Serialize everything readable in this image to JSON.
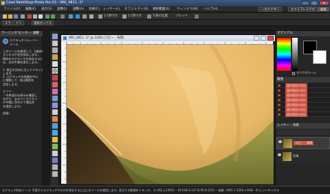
{
  "window": {
    "title": "Corel PaintShop Photo Pro X3 - IMG_4811 -1*",
    "minimize_glyph": "–",
    "maximize_glyph": "□",
    "close_glyph": "✕"
  },
  "menubar": {
    "items": [
      "ファイル(F)",
      "編集(E)",
      "表示(V)",
      "画像(I)",
      "調整(A)",
      "効果(C)",
      "レイヤー(L)",
      "オブジェクト(O)",
      "選択範囲(S)",
      "ウィンドウ(W)",
      "ヘルプ(H)"
    ],
    "workspace_buttons": [
      "ーガナイザー",
      "エクスプレスラボ",
      "編集"
    ]
  },
  "toolbar": {
    "zoom_1": "1:1原寸大",
    "zoom_2": "1:1原寸大",
    "fit_label": "写真の位置",
    "palette_label": "パレット"
  },
  "optbar": {
    "tabs": [
      "スラ",
      "ドリ",
      "選択ボックス"
    ]
  },
  "learning_center": {
    "header": "ラーニング センター: 調整",
    "tool_name_line1": "スクラッチリムーバー",
    "tool_name_line2": "ツール",
    "lines": [
      "このツールを使用して、比較的小",
      "さいキズや毛を除去します。",
      "線状のスクラッチを除去するに",
      "は、次の手順を実行します。",
      "",
      "1. 修正の方向に沿ってドラッグ",
      "   します。",
      "2. スクラッチの両端を中心",
      "   に移動して、修正範囲を",
      "   決定します。",
      "",
      "ヒント:",
      "・中央部分の表示を確認し",
      "  ながら、なるべくスクラッ",
      "  チの幅に合わせて補正枠",
      "  を設定します。",
      "",
      "詳細..."
    ]
  },
  "document": {
    "tab_title": "IMG_4811 -1* @ 120% (コピー - 背景)"
  },
  "palettes": {
    "materials_header": "マテリアル",
    "all_tools": "すべてのツール",
    "history_header": "履歴",
    "history_items": [
      "選択範囲を保存",
      "選択範囲を保存",
      "選択範囲を保存",
      "選択範囲を保存",
      "選択範囲を保存",
      "選択範囲を保存",
      "選択範囲を保存"
    ],
    "layers_header": "レイヤー - 背景",
    "layers": [
      {
        "name": "コピー - 背景"
      },
      {
        "name": "背景"
      }
    ]
  },
  "statusbar": {
    "text": "スクラッチ除去ツール: 写真からスクラッチやひびを除去するにはこのツールを使用します。修正する範囲をドラッグ。 (x:362 y:1450) -- (R:169,G:137,B:95,O:255) -- 画像: 3465 x 5202 x RGB - 8 ビット/チャネル"
  },
  "colors": {
    "accent": "#d14d3c",
    "title_blue": "#3c5a82",
    "panel_bg": "#262626"
  }
}
